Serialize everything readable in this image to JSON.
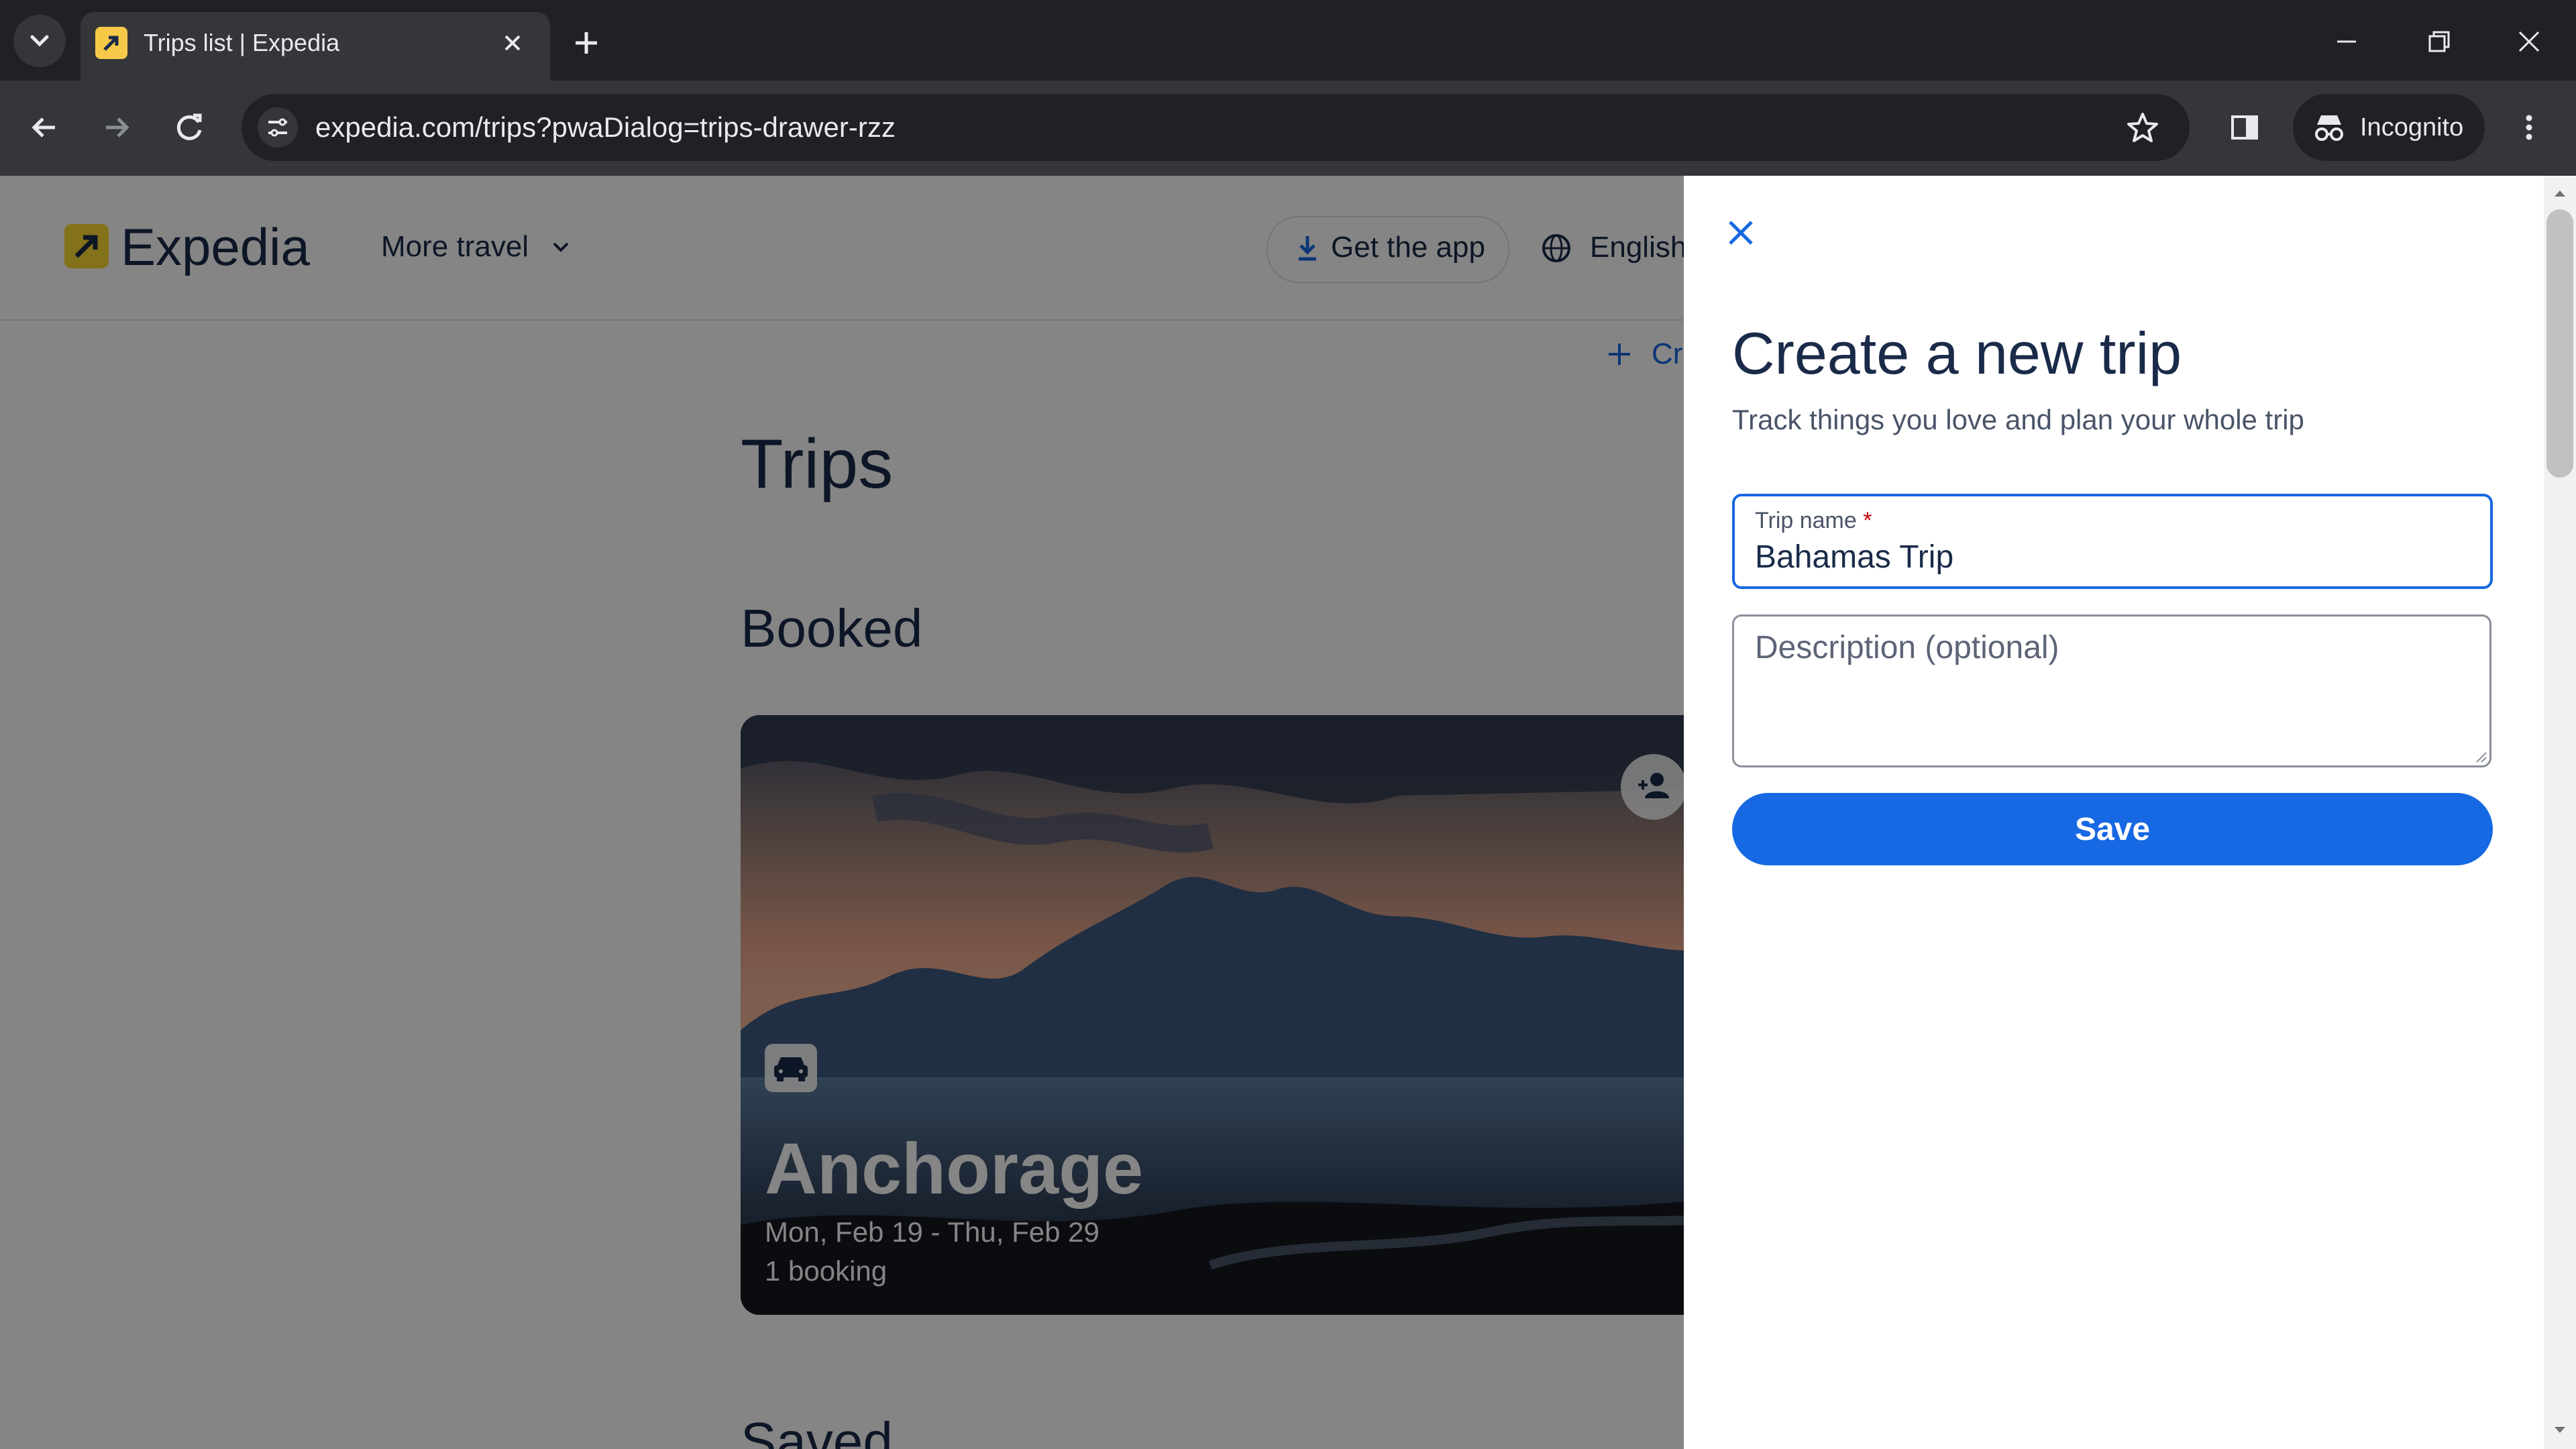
{
  "browser": {
    "tab_title": "Trips list | Expedia",
    "url": "expedia.com/trips?pwaDialog=trips-drawer-rzz",
    "incognito_label": "Incognito"
  },
  "site": {
    "logo_text": "Expedia",
    "more_travel": "More travel",
    "get_app": "Get the app",
    "language": "English",
    "create_link": "Cr"
  },
  "trips": {
    "title": "Trips",
    "booked_heading": "Booked",
    "saved_heading": "Saved",
    "card": {
      "city": "Anchorage",
      "dates": "Mon, Feb 19 - Thu, Feb 29",
      "bookings": "1 booking"
    }
  },
  "drawer": {
    "title": "Create a new trip",
    "subtitle": "Track things you love and plan your whole trip",
    "trip_name_label": "Trip name",
    "required_mark": "*",
    "trip_name_value": "Bahamas Trip",
    "description_placeholder": "Description (optional)",
    "save_label": "Save"
  },
  "colors": {
    "brand_blue": "#1668e3",
    "brand_yellow": "#fddb32",
    "text_dark": "#1a2b49"
  }
}
